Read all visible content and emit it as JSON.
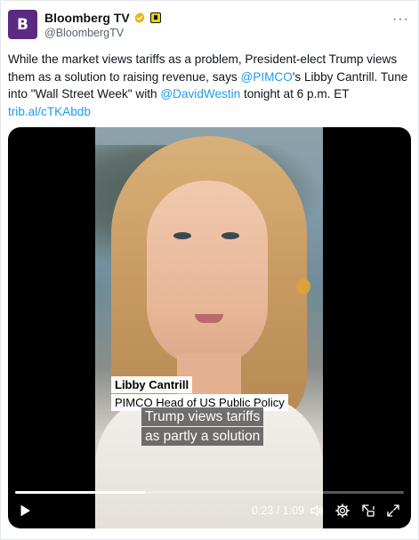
{
  "account": {
    "display_name": "Bloomberg TV",
    "handle": "@BloombergTV",
    "avatar_letter": "B",
    "avatar_color": "#5b2a82",
    "verified_color": "#e2b719"
  },
  "more_label": "···",
  "tweet": {
    "line1": "While the market views tariffs as a problem, President-elect Trump views",
    "line2_a": "them as a solution to raising revenue, says ",
    "mention1": "@PIMCO",
    "line2_b": "'s Libby Cantrill. Tune",
    "line3_a": "into \"Wall Street Week\" with ",
    "mention2": "@DavidWestin",
    "line3_b": " tonight at 6 p.m. ET",
    "link": "trib.al/cTKAbdb"
  },
  "video": {
    "lower_third_name": "Libby Cantrill",
    "lower_third_title": "PIMCO Head of US Public Policy",
    "caption_line1": "Trump views tariffs",
    "caption_line2": "as partly a solution",
    "time_display": "0:23 / 1:09",
    "progress_fraction": 0.333,
    "link_color": "#1d9bf0"
  }
}
